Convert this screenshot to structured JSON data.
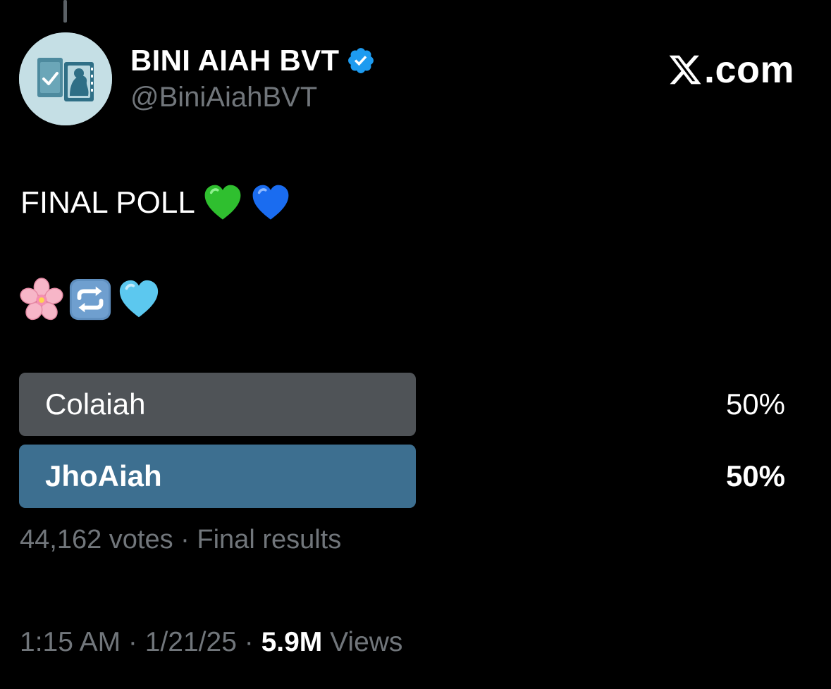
{
  "author": {
    "display_name": "BINI AIAH BVT",
    "handle": "@BiniAiahBVT",
    "verified": true
  },
  "brand": {
    "text": ".com",
    "icon": "x-logo-icon"
  },
  "tweet": {
    "text": "FINAL POLL",
    "title_emojis": [
      "green-heart-icon",
      "blue-heart-icon"
    ],
    "emoji_line": [
      "cherry-blossom-icon",
      "repeat-icon",
      "light-blue-heart-icon"
    ]
  },
  "poll": {
    "options": [
      {
        "label": "Colaiah",
        "percent_text": "50%",
        "percent": 50,
        "winner": false
      },
      {
        "label": "JhoAiah",
        "percent_text": "50%",
        "percent": 50,
        "winner": true
      }
    ],
    "votes_text": "44,162 votes",
    "separator": " · ",
    "status_text": "Final results"
  },
  "footer": {
    "time": "1:15 AM",
    "date": "1/21/25",
    "separator": " · ",
    "views_count": "5.9M",
    "views_label": " Views"
  },
  "colors": {
    "background": "#000000",
    "secondary_text": "#71767b",
    "winner_bar": "#3d6f90",
    "loser_bar": "#4f5357",
    "verified_badge": "#1d9bf0"
  }
}
